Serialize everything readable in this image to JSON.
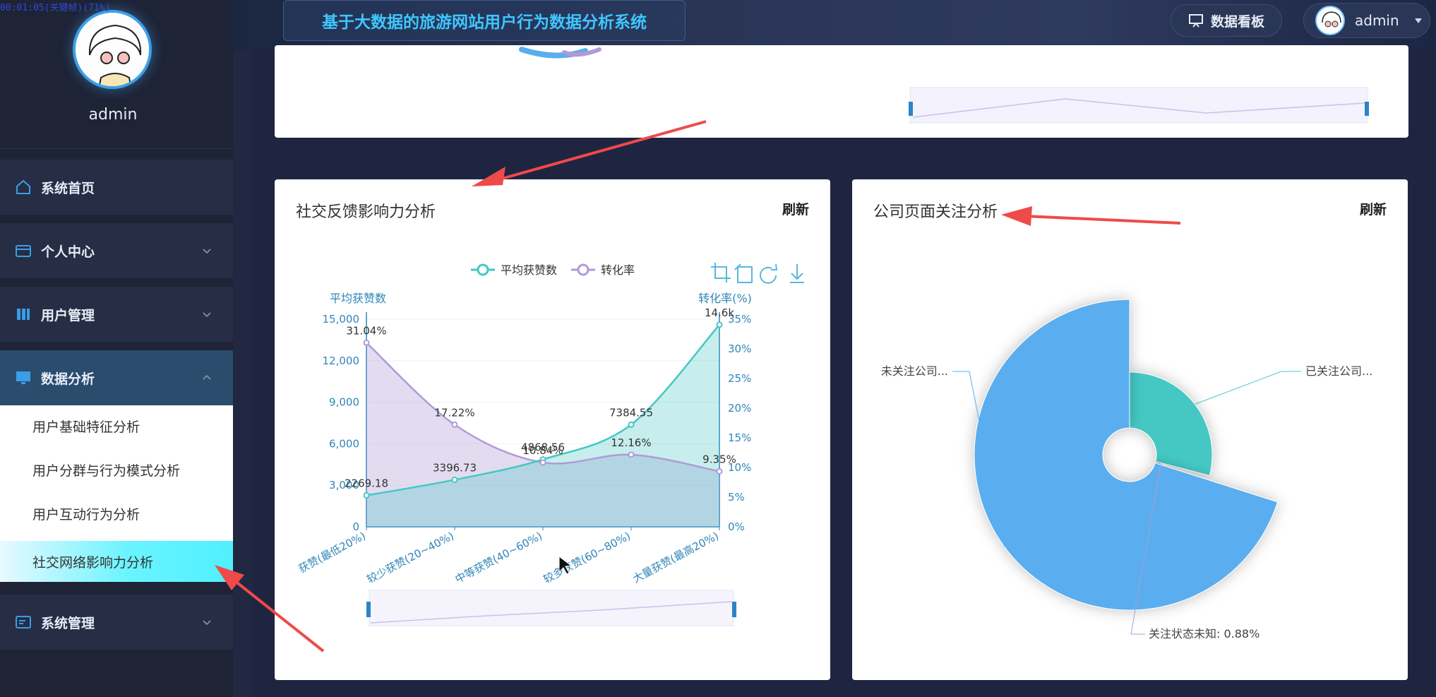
{
  "app": {
    "timestamp": "00:01:05(关键帧)(71%)",
    "system_title": "基于大数据的旅游网站用户行为数据分析系统"
  },
  "header": {
    "dashboard_label": "数据看板",
    "username": "admin"
  },
  "sidebar": {
    "username": "admin",
    "items": [
      {
        "label": "系统首页"
      },
      {
        "label": "个人中心"
      },
      {
        "label": "用户管理"
      },
      {
        "label": "数据分析"
      },
      {
        "label": "系统管理"
      }
    ],
    "sub_items": [
      {
        "label": "用户基础特征分析"
      },
      {
        "label": "用户分群与行为模式分析"
      },
      {
        "label": "用户互动行为分析"
      },
      {
        "label": "社交网络影响力分析"
      }
    ]
  },
  "cards": {
    "social": {
      "title": "社交反馈影响力分析",
      "refresh": "刷新"
    },
    "company": {
      "title": "公司页面关注分析",
      "refresh": "刷新"
    }
  },
  "colors": {
    "teal": "#45c8c4",
    "purple": "#b09ad8",
    "blue": "#5aaeef",
    "axis": "#2f86b8",
    "arrow": "#ef4a4a"
  },
  "chart_data": [
    {
      "type": "line",
      "legend": [
        "平均获赞数",
        "转化率"
      ],
      "ylabel_left": "平均获赞数",
      "ylabel_right": "转化率(%)",
      "categories": [
        "获赞(最低20%)",
        "较少获赞(20~40%)",
        "中等获赞(40~60%)",
        "较多获赞(60~80%)",
        "大量获赞(最高20%)"
      ],
      "y_left_ticks": [
        "0",
        "3,000",
        "6,000",
        "9,000",
        "12,000",
        "15,000"
      ],
      "y_right_ticks": [
        "0%",
        "5%",
        "10%",
        "15%",
        "20%",
        "25%",
        "30%",
        "35%"
      ],
      "ylim_left": [
        0,
        15000
      ],
      "ylim_right": [
        0,
        35
      ],
      "series": [
        {
          "name": "平均获赞数",
          "values": [
            2269.18,
            3396.73,
            4868.56,
            7384.55,
            14600
          ],
          "labels": [
            "2269.18",
            "3396.73",
            "4868.56",
            "7384.55",
            "14.6k"
          ]
        },
        {
          "name": "转化率",
          "values": [
            31.04,
            17.22,
            10.84,
            12.16,
            9.35
          ],
          "labels": [
            "31.04%",
            "17.22%",
            "10.84%",
            "12.16%",
            "9.35%"
          ]
        }
      ]
    },
    {
      "type": "pie",
      "slices": [
        {
          "label": "未关注公司...",
          "value": 70
        },
        {
          "label": "已关注公司...",
          "value": 29
        },
        {
          "label": "关注状态未知: 0.88%",
          "value": 0.88
        }
      ]
    }
  ]
}
